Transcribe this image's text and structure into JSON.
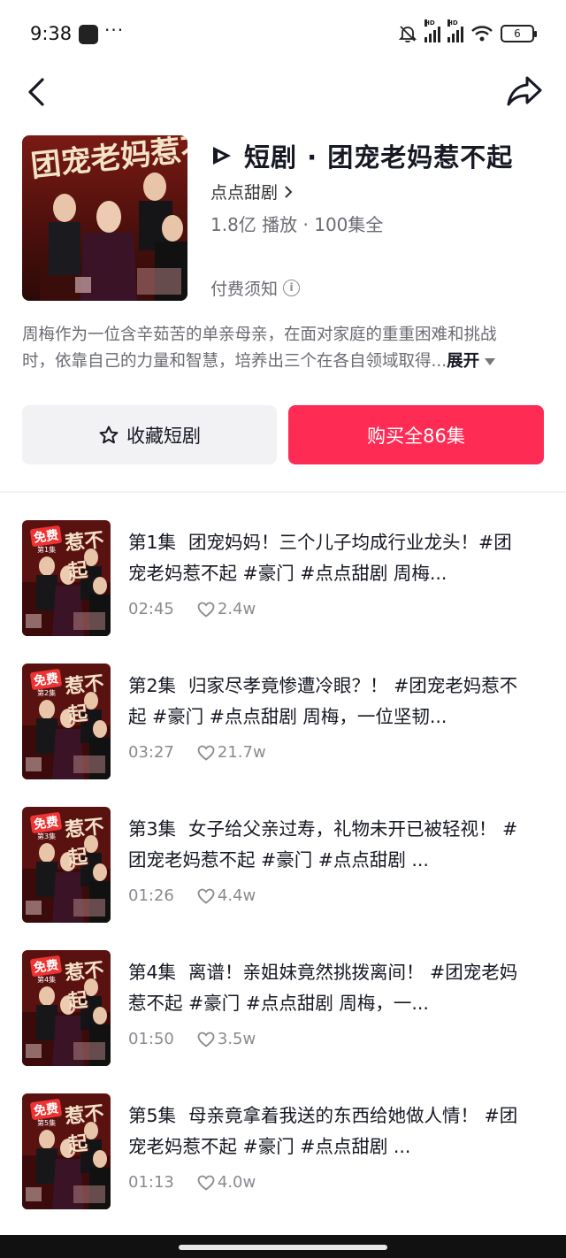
{
  "status_bar": {
    "time": "9:38",
    "more": "···",
    "battery": "6",
    "hd1": "HD",
    "hd2": "HD"
  },
  "nav": {
    "back_icon": "chevron-left-icon",
    "share_icon": "share-arrow-icon"
  },
  "drama": {
    "title": "短剧 · 团宠老妈惹不起",
    "logo_icon": "play-logo-icon",
    "publisher": "点点甜剧",
    "stats": "1.8亿 播放 · 100集全",
    "pay_note": "付费须知",
    "description_line1": "周梅作为一位含辛茹苦的单亲母亲，在面对家庭的重重困难和挑战",
    "description_line2": "时，依靠自己的力量和智慧，培养出三个在各自领域取得...",
    "expand_label": "展开"
  },
  "actions": {
    "favorite_label": "收藏短剧",
    "buy_label": "购买全86集"
  },
  "thumb": {
    "free_label": "免费",
    "title_glyph": "惹不起"
  },
  "episodes": [
    {
      "no": "第1集",
      "tag": "第1集",
      "title": "团宠妈妈！三个儿子均成行业龙头！#团宠老妈惹不起 #豪门 #点点甜剧 周梅...",
      "duration": "02:45",
      "likes": "2.4w"
    },
    {
      "no": "第2集",
      "tag": "第2集",
      "title": "归家尽孝竟惨遭冷眼？！ #团宠老妈惹不起 #豪门 #点点甜剧 周梅，一位坚韧...",
      "duration": "03:27",
      "likes": "21.7w"
    },
    {
      "no": "第3集",
      "tag": "第3集",
      "title": "女子给父亲过寿，礼物未开已被轻视！ #团宠老妈惹不起 #豪门 #点点甜剧 ...",
      "duration": "01:26",
      "likes": "4.4w"
    },
    {
      "no": "第4集",
      "tag": "第4集",
      "title": "离谱！亲姐妹竟然挑拨离间！ #团宠老妈惹不起 #豪门 #点点甜剧 周梅，一...",
      "duration": "01:50",
      "likes": "3.5w"
    },
    {
      "no": "第5集",
      "tag": "第5集",
      "title": "母亲竟拿着我送的东西给她做人情！ #团宠老妈惹不起 #豪门 #点点甜剧 ...",
      "duration": "01:13",
      "likes": "4.0w"
    }
  ],
  "colors": {
    "accent": "#fe2c55",
    "secondary_text": "#6b6c73"
  }
}
